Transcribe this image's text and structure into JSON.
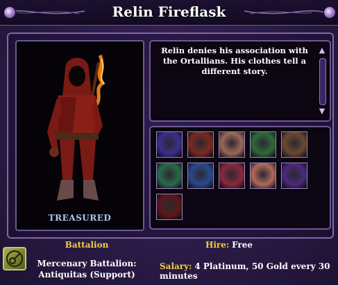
{
  "window": {
    "title": "Relin Fireflask"
  },
  "portrait": {
    "rarity_label": "TREASURED"
  },
  "description": {
    "text": "Relin denies his association with the Ortallians. His clothes tell a different story."
  },
  "powers": [
    {
      "icon": "purple-figure-power-icon",
      "color": "#3a2f8a"
    },
    {
      "icon": "hand-shield-power-icon",
      "color": "#7a2a20"
    },
    {
      "icon": "closed-eyes-face-power-icon",
      "color": "#9a6a5a"
    },
    {
      "icon": "bone-green-power-icon",
      "color": "#2f6a3a"
    },
    {
      "icon": "thrown-bone-power-icon",
      "color": "#6a4a30"
    },
    {
      "icon": "green-swirl-power-icon",
      "color": "#2a6a4a"
    },
    {
      "icon": "blue-figure-aura-power-icon",
      "color": "#2a4a8a"
    },
    {
      "icon": "blue-hand-spark-power-icon",
      "color": "#8a2a3a"
    },
    {
      "icon": "screaming-face-power-icon",
      "color": "#b06a5a"
    },
    {
      "icon": "purple-lightning-power-icon",
      "color": "#4a2a7a"
    },
    {
      "icon": "glowing-head-power-icon",
      "color": "#5a1818"
    }
  ],
  "footer": {
    "battalion_heading": "Battalion",
    "battalion_line1": "Mercenary Battalion:",
    "battalion_line2": "Antiquitas (Support)",
    "hire_label": "Hire:",
    "hire_value": "Free",
    "salary_label": "Salary:",
    "salary_value": "4 Platinum, 50 Gold every 30 minutes"
  }
}
